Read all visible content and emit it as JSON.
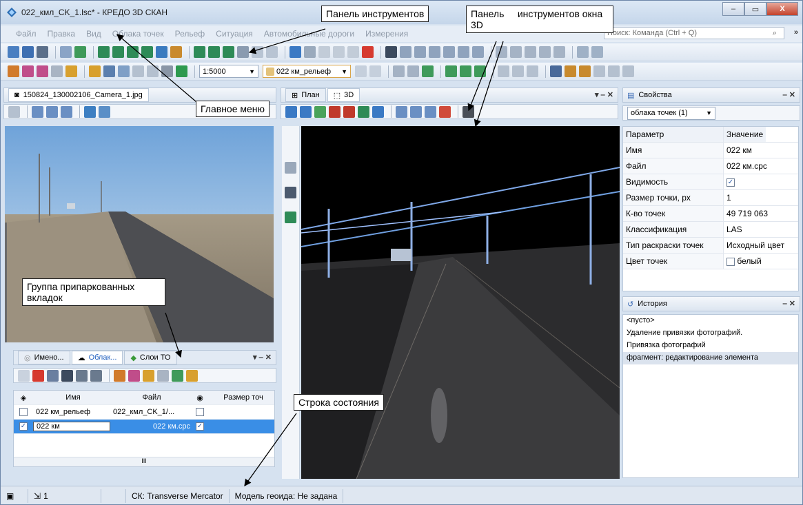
{
  "window": {
    "title": "022_кмл_CK_1.lsc* - КРЕДО 3D СКАН",
    "min": "‒",
    "max": "▭",
    "close": "X"
  },
  "menu": {
    "items": [
      "Файл",
      "Правка",
      "Вид",
      "Облака точек",
      "Рельеф",
      "Ситуация",
      "Автомобильные дороги",
      "Измерения"
    ],
    "search_placeholder": "Поиск: Команда (Ctrl + Q)"
  },
  "toolbar2": {
    "scale": "1:5000",
    "layer": "022 км_рельеф"
  },
  "photo_panel": {
    "tab": "150824_130002106_Camera_1.jpg"
  },
  "view_panel": {
    "tabs": [
      "План",
      "3D"
    ]
  },
  "props_panel": {
    "title": "Свойства",
    "selector": "облака точек (1)",
    "headers": [
      "Параметр",
      "Значение"
    ],
    "rows": [
      {
        "k": "Имя",
        "v": "022 км"
      },
      {
        "k": "Файл",
        "v": "022 км.cpc"
      },
      {
        "k": "Видимость",
        "v": "✓"
      },
      {
        "k": "Размер точки, px",
        "v": "1"
      },
      {
        "k": "К-во точек",
        "v": "49 719 063"
      },
      {
        "k": "Классификация",
        "v": "LAS"
      },
      {
        "k": "Тип раскраски точек",
        "v": "Исходный цвет"
      },
      {
        "k": "Цвет точек",
        "v": "белый"
      }
    ]
  },
  "history_panel": {
    "title": "История",
    "items": [
      "<пусто>",
      "Удаление привязки фотографий.",
      "Привязка фотографий",
      "фрагмент: редактирование элемента"
    ]
  },
  "cloud_panel": {
    "tabs": [
      "Имено...",
      "Облак...",
      "Слои ТО"
    ],
    "headers": [
      "Имя",
      "Файл",
      "Размер точ"
    ],
    "rows": [
      {
        "name": "022 км_рельеф",
        "file": "022_кмл_CK_1/...",
        "checked": false
      },
      {
        "name": "022 км",
        "file": "022 км.cpc",
        "checked": true
      }
    ],
    "scroll_mark": "III"
  },
  "status": {
    "sel_count": "1",
    "cs": "СК: Transverse Mercator",
    "geoid": "Модель геоида: Не задана"
  },
  "callouts": {
    "toolbar": "Панель инструментов",
    "toolbar3d": "Панель     инструментов окна 3D",
    "mainmenu": "Главное меню",
    "docked": "Группа припаркованных вкладок",
    "statusbar": "Строка состояния"
  }
}
